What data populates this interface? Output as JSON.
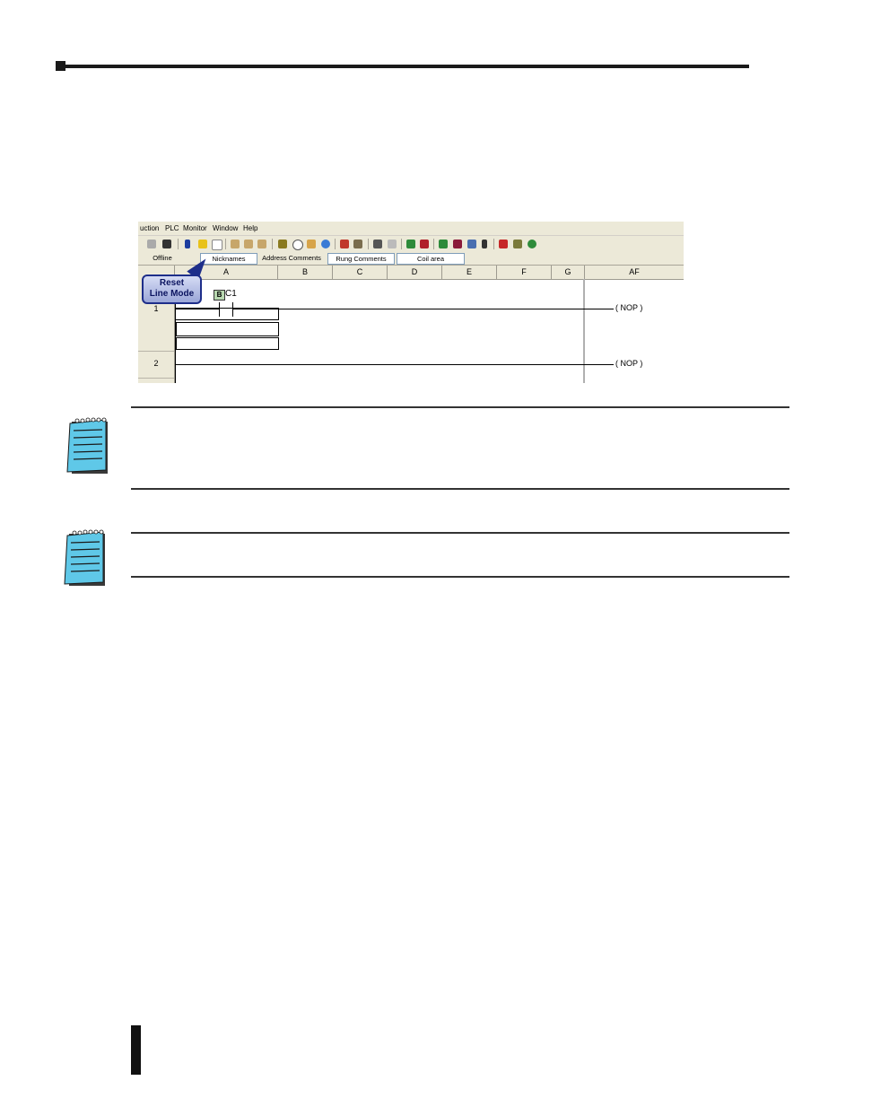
{
  "screenshot": {
    "menu": [
      "uction",
      "PLC",
      "Monitor",
      "Window",
      "Help"
    ],
    "status": {
      "offline": "Offline",
      "nicknames": "Nicknames",
      "address_comments": "Address Comments",
      "rung_comments": "Rung Comments",
      "coil_area": "Coil area"
    },
    "columns": [
      "A",
      "B",
      "C",
      "D",
      "E",
      "F",
      "G",
      "AF"
    ],
    "rows": [
      "1",
      "2"
    ],
    "contact_badge": "B",
    "contact_label": "C1",
    "coil_1": "( NOP )",
    "coil_2": "( NOP )",
    "callout": {
      "line1": "Reset",
      "line2": "Line Mode"
    }
  }
}
